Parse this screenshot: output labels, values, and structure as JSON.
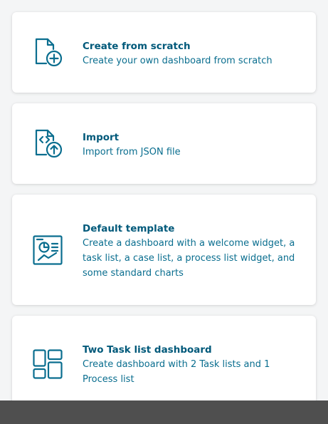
{
  "colors": {
    "accent": "#0a6e8f",
    "title": "#00597a",
    "footer": "#4f4f4f"
  },
  "cards": [
    {
      "icon": "file-plus-icon",
      "title": "Create from scratch",
      "description": "Create your own dashboard from scratch"
    },
    {
      "icon": "file-code-upload-icon",
      "title": "Import",
      "description": "Import from JSON file"
    },
    {
      "icon": "dashboard-template-icon",
      "title": "Default template",
      "description": "Create a dashboard with a welcome widget, a task list, a case list, a process list widget, and some standard charts"
    },
    {
      "icon": "layout-grid-icon",
      "title": "Two Task list dashboard",
      "description": "Create dashboard with 2 Task lists and 1 Process list"
    }
  ]
}
